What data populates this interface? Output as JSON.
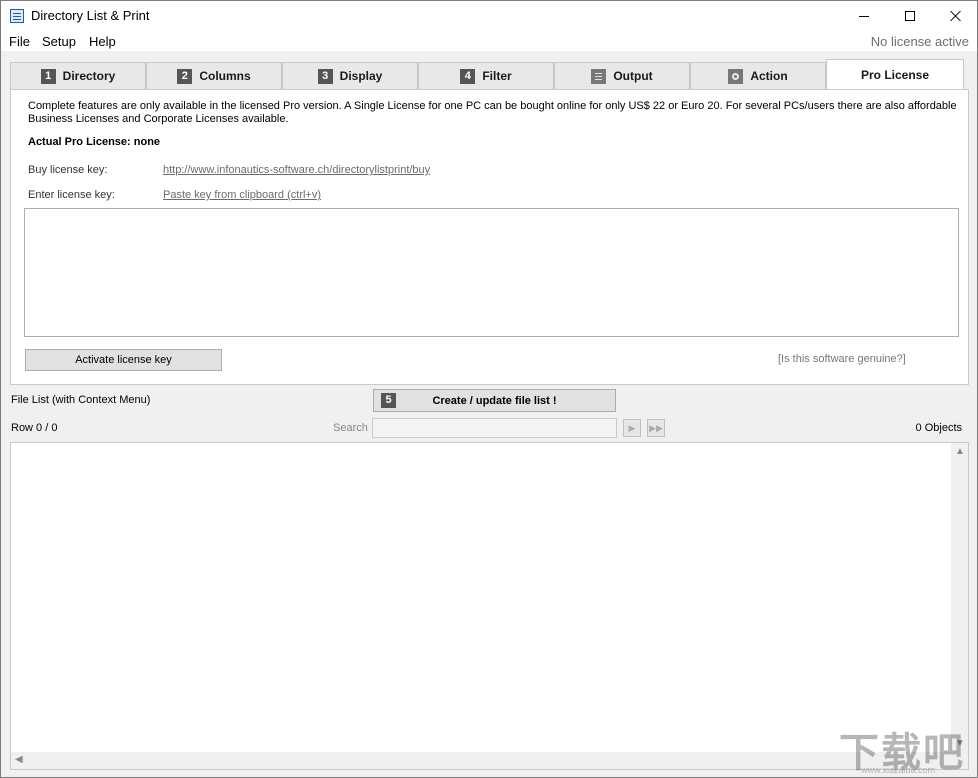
{
  "window": {
    "title": "Directory List & Print"
  },
  "menu": {
    "items": [
      "File",
      "Setup",
      "Help"
    ],
    "license_status": "No license active"
  },
  "tabs": [
    {
      "num": "1",
      "label": "Directory"
    },
    {
      "num": "2",
      "label": "Columns"
    },
    {
      "num": "3",
      "label": "Display"
    },
    {
      "num": "4",
      "label": "Filter"
    },
    {
      "icon": "document-icon",
      "label": "Output"
    },
    {
      "icon": "gear-icon",
      "label": "Action"
    },
    {
      "label": "Pro License",
      "active": true
    }
  ],
  "license_panel": {
    "info": "Complete features are only available in the licensed Pro version. A Single License for one PC can be bought online for only US$ 22 or Euro 20. For several PCs/users there are also affordable Business Licenses and Corporate Licenses available.",
    "actual_license": "Actual Pro License: none",
    "buy_label": "Buy license key:",
    "buy_link": "http://www.infonautics-software.ch/directorylistprint/buy",
    "enter_label": "Enter license key:",
    "paste_link": "Paste key from clipboard (ctrl+v)",
    "key_value": "",
    "activate_button": "Activate license key",
    "genuine_link": "[Is this software genuine?]"
  },
  "file_list": {
    "label": "File List (with Context Menu)",
    "create_num": "5",
    "create_button": "Create / update file list !",
    "row_label": "Row 0 / 0",
    "search_label": "Search",
    "search_value": "",
    "objects_label": "0 Objects"
  },
  "watermark": {
    "text": "下载吧",
    "sub": "www.xiazaiba.com"
  }
}
